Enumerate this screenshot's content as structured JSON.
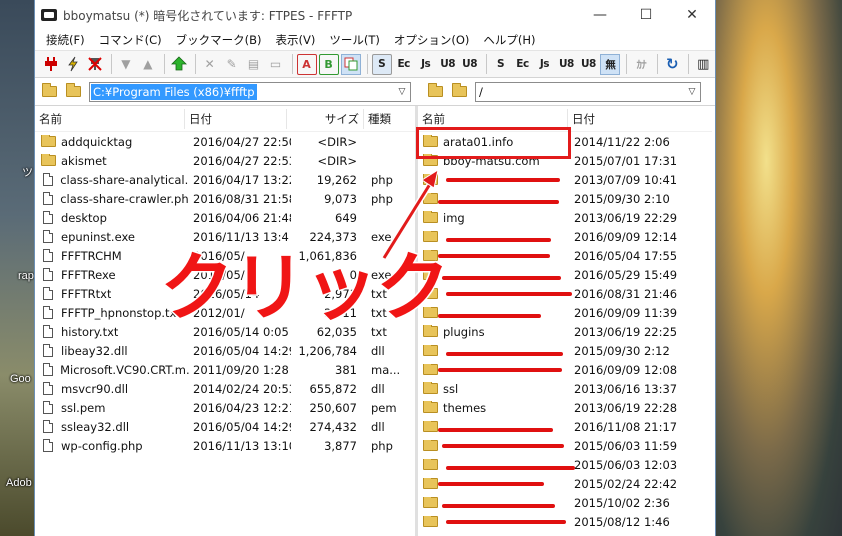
{
  "window": {
    "title": "bboymatsu (*) 暗号化されています: FTPES - FFFTP",
    "controls": {
      "minimize": "—",
      "maximize": "☐",
      "close": "✕"
    }
  },
  "menu": [
    "接続(F)",
    "コマンド(C)",
    "ブックマーク(B)",
    "表示(V)",
    "ツール(T)",
    "オプション(O)",
    "ヘルプ(H)"
  ],
  "toolbar": {
    "text_buttons": {
      "upload_s": "S",
      "euc": "Ec",
      "jis": "Js",
      "utf8n": "U8",
      "utf8": "U8",
      "r_upload_s": "S",
      "r_euc": "Ec",
      "r_jis": "Js",
      "r_utf8n": "U8",
      "r_utf8": "U8",
      "none": "無",
      "kana": "ｶﾅ"
    },
    "mode_buttons": {
      "ascii": "A",
      "binary": "B"
    }
  },
  "local": {
    "path": "C:¥Program Files (x86)¥ffftp",
    "columns": {
      "name": "名前",
      "date": "日付",
      "size": "サイズ",
      "type": "種類"
    },
    "files": [
      {
        "icon": "folder",
        "name": "addquicktag",
        "date": "2016/04/27 22:50",
        "size": "<DIR>",
        "type": ""
      },
      {
        "icon": "folder",
        "name": "akismet",
        "date": "2016/04/27 22:53",
        "size": "<DIR>",
        "type": ""
      },
      {
        "icon": "file",
        "name": "class-share-analytical...",
        "date": "2016/04/17 13:22",
        "size": "19,262",
        "type": "php"
      },
      {
        "icon": "file",
        "name": "class-share-crawler.php",
        "date": "2016/08/31 21:58",
        "size": "9,073",
        "type": "php"
      },
      {
        "icon": "file",
        "name": "desktop",
        "date": "2016/04/06 21:48",
        "size": "649",
        "type": ""
      },
      {
        "icon": "file",
        "name": "epuninst.exe",
        "date": "2016/11/13 13:4",
        "size": "224,373",
        "type": "exe"
      },
      {
        "icon": "file",
        "name": "FFFTRCHM",
        "date": "2016/05/",
        "size": "1,061,836",
        "type": ""
      },
      {
        "icon": "file",
        "name": "FFFTRexe",
        "date": "2016/05/",
        "size": "0",
        "type": "exe"
      },
      {
        "icon": "file",
        "name": "FFFTRtxt",
        "date": "2016/05/14",
        "size": "2,971",
        "type": "txt"
      },
      {
        "icon": "file",
        "name": "FFFTP_hpnonstop.txt",
        "date": "2012/01/",
        "size": "2,311",
        "type": "txt"
      },
      {
        "icon": "file",
        "name": "history.txt",
        "date": "2016/05/14 0:05",
        "size": "62,035",
        "type": "txt"
      },
      {
        "icon": "file",
        "name": "libeay32.dll",
        "date": "2016/05/04 14:29",
        "size": "1,206,784",
        "type": "dll"
      },
      {
        "icon": "file",
        "name": "Microsoft.VC90.CRT.m...",
        "date": "2011/09/20 1:28",
        "size": "381",
        "type": "ma..."
      },
      {
        "icon": "file",
        "name": "msvcr90.dll",
        "date": "2014/02/24 20:53",
        "size": "655,872",
        "type": "dll"
      },
      {
        "icon": "file",
        "name": "ssl.pem",
        "date": "2016/04/23 12:21",
        "size": "250,607",
        "type": "pem"
      },
      {
        "icon": "file",
        "name": "ssleay32.dll",
        "date": "2016/05/04 14:29",
        "size": "274,432",
        "type": "dll"
      },
      {
        "icon": "file",
        "name": "wp-config.php",
        "date": "2016/11/13 13:10",
        "size": "3,877",
        "type": "php"
      }
    ]
  },
  "remote": {
    "path": "/",
    "columns": {
      "name": "名前",
      "date": "日付"
    },
    "files": [
      {
        "name": "arata01.info",
        "date": "2014/11/22 2:06",
        "redacted": false
      },
      {
        "name": "bboy-matsu.com",
        "date": "2015/07/01 17:31",
        "redacted": false
      },
      {
        "name": "",
        "date": "2013/07/09 10:41",
        "redacted": true
      },
      {
        "name": "",
        "date": "2015/09/30 2:10",
        "redacted": true
      },
      {
        "name": "img",
        "date": "2013/06/19 22:29",
        "redacted": false
      },
      {
        "name": "",
        "date": "2016/09/09 12:14",
        "redacted": true
      },
      {
        "name": "",
        "date": "2016/05/04 17:55",
        "redacted": true
      },
      {
        "name": "",
        "date": "2016/05/29 15:49",
        "redacted": true
      },
      {
        "name": "",
        "date": "2016/08/31 21:46",
        "redacted": true
      },
      {
        "name": "",
        "date": "2016/09/09 11:39",
        "redacted": true
      },
      {
        "name": "plugins",
        "date": "2013/06/19 22:25",
        "redacted": false
      },
      {
        "name": "",
        "date": "2015/09/30 2:12",
        "redacted": true
      },
      {
        "name": "",
        "date": "2016/09/09 12:08",
        "redacted": true
      },
      {
        "name": "ssl",
        "date": "2013/06/16 13:37",
        "redacted": false
      },
      {
        "name": "themes",
        "date": "2013/06/19 22:28",
        "redacted": false
      },
      {
        "name": "",
        "date": "2016/11/08 21:17",
        "redacted": true
      },
      {
        "name": "",
        "date": "2015/06/03 11:59",
        "redacted": true
      },
      {
        "name": "",
        "date": "2015/06/03 12:03",
        "redacted": true
      },
      {
        "name": "",
        "date": "2015/02/24 22:42",
        "redacted": true
      },
      {
        "name": "",
        "date": "2015/10/02 2:36",
        "redacted": true
      },
      {
        "name": "",
        "date": "2015/08/12 1:46",
        "redacted": true
      }
    ]
  },
  "annotation": {
    "label": "クリック",
    "color": "#f01515"
  },
  "desktop": {
    "labels": [
      "ツ",
      "rap",
      "Goo",
      "Adob"
    ]
  }
}
